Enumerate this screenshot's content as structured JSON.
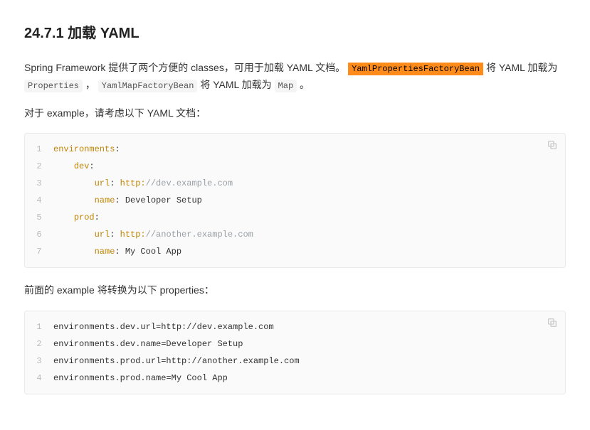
{
  "heading": "24.7.1 加载 YAML",
  "p1": {
    "t1": "Spring Framework 提供了两个方便的 classes，可用于加载 YAML 文档。 ",
    "hl": "YamlPropertiesFactoryBean",
    "t2": " 将 YAML 加载为 ",
    "c1": "Properties",
    "t3": " ， ",
    "c2": "YamlMapFactoryBean",
    "t4": " 将 YAML 加载为 ",
    "c3": "Map",
    "t5": " 。"
  },
  "p2": "对于 example，请考虑以下 YAML 文档：",
  "code1": {
    "lines": [
      {
        "n": "1",
        "segs": [
          {
            "cls": "tok-key",
            "t": "environments"
          },
          {
            "cls": "tok-plain",
            "t": ":"
          }
        ]
      },
      {
        "n": "2",
        "segs": [
          {
            "cls": "tok-plain",
            "t": "    "
          },
          {
            "cls": "tok-key",
            "t": "dev"
          },
          {
            "cls": "tok-plain",
            "t": ":"
          }
        ]
      },
      {
        "n": "3",
        "segs": [
          {
            "cls": "tok-plain",
            "t": "        "
          },
          {
            "cls": "tok-key",
            "t": "url"
          },
          {
            "cls": "tok-plain",
            "t": ": "
          },
          {
            "cls": "tok-str",
            "t": "http:"
          },
          {
            "cls": "tok-cmt",
            "t": "//dev.example.com"
          }
        ]
      },
      {
        "n": "4",
        "segs": [
          {
            "cls": "tok-plain",
            "t": "        "
          },
          {
            "cls": "tok-key",
            "t": "name"
          },
          {
            "cls": "tok-plain",
            "t": ": Developer Setup"
          }
        ]
      },
      {
        "n": "5",
        "segs": [
          {
            "cls": "tok-plain",
            "t": "    "
          },
          {
            "cls": "tok-key",
            "t": "prod"
          },
          {
            "cls": "tok-plain",
            "t": ":"
          }
        ]
      },
      {
        "n": "6",
        "segs": [
          {
            "cls": "tok-plain",
            "t": "        "
          },
          {
            "cls": "tok-key",
            "t": "url"
          },
          {
            "cls": "tok-plain",
            "t": ": "
          },
          {
            "cls": "tok-str",
            "t": "http:"
          },
          {
            "cls": "tok-cmt",
            "t": "//another.example.com"
          }
        ]
      },
      {
        "n": "7",
        "segs": [
          {
            "cls": "tok-plain",
            "t": "        "
          },
          {
            "cls": "tok-key",
            "t": "name"
          },
          {
            "cls": "tok-plain",
            "t": ": My Cool App"
          }
        ]
      }
    ]
  },
  "p3": "前面的 example 将转换为以下 properties：",
  "code2": {
    "lines": [
      {
        "n": "1",
        "segs": [
          {
            "cls": "tok-plain",
            "t": "environments.dev.url=http://dev.example.com"
          }
        ]
      },
      {
        "n": "2",
        "segs": [
          {
            "cls": "tok-plain",
            "t": "environments.dev.name=Developer Setup"
          }
        ]
      },
      {
        "n": "3",
        "segs": [
          {
            "cls": "tok-plain",
            "t": "environments.prod.url=http://another.example.com"
          }
        ]
      },
      {
        "n": "4",
        "segs": [
          {
            "cls": "tok-plain",
            "t": "environments.prod.name=My Cool App"
          }
        ]
      }
    ]
  }
}
